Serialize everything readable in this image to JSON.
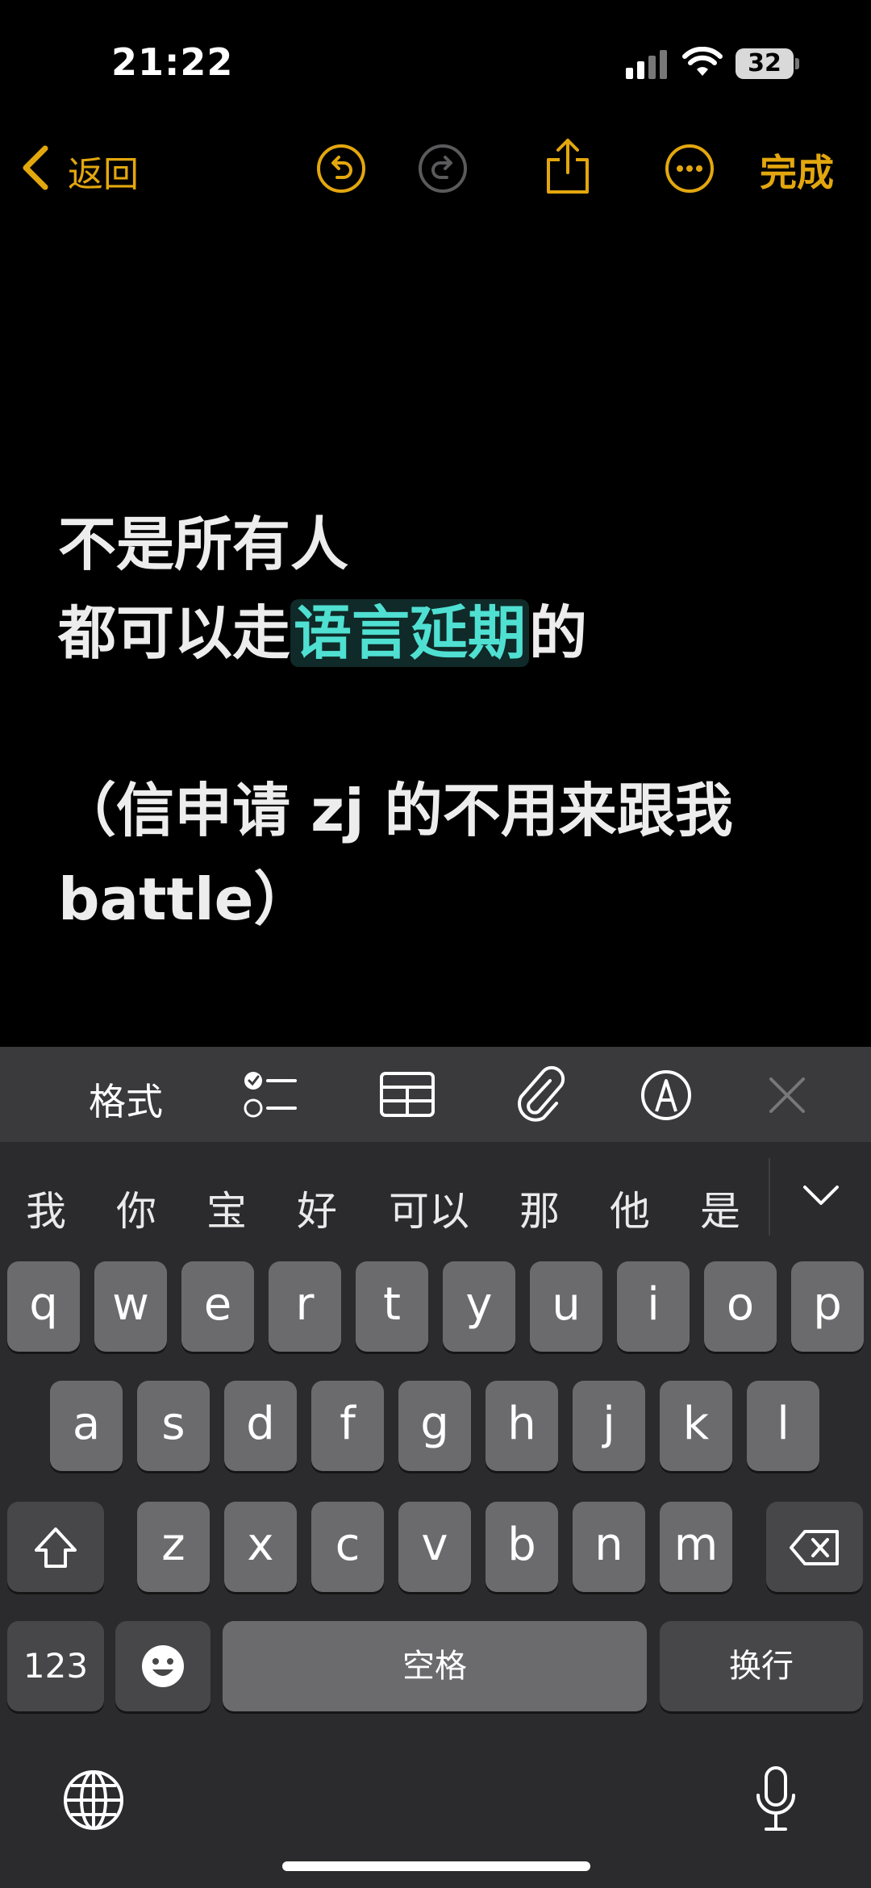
{
  "status": {
    "time": "21:22",
    "battery": "32"
  },
  "nav": {
    "back_label": "返回",
    "done_label": "完成"
  },
  "note": {
    "line1": "不是所有人",
    "line2_pre": "都可以走",
    "line2_highlight": "语言延期",
    "line2_post": "的",
    "line3": "（信申请 zj 的不用来跟我",
    "line4": "battle）"
  },
  "format_bar": {
    "format_label": "格式"
  },
  "candidates": [
    "我",
    "你",
    "宝",
    "好",
    "可以",
    "那",
    "他",
    "是"
  ],
  "keyboard": {
    "row1": [
      "q",
      "w",
      "e",
      "r",
      "t",
      "y",
      "u",
      "i",
      "o",
      "p"
    ],
    "row2": [
      "a",
      "s",
      "d",
      "f",
      "g",
      "h",
      "j",
      "k",
      "l"
    ],
    "row3": [
      "z",
      "x",
      "c",
      "v",
      "b",
      "n",
      "m"
    ],
    "numbers_label": "123",
    "space_label": "空格",
    "return_label": "换行"
  },
  "colors": {
    "accent": "#e3a70e",
    "highlight_text": "#4fe0d2",
    "keyboard_bg": "#2b2b2d",
    "key_bg": "#6b6b6d"
  }
}
